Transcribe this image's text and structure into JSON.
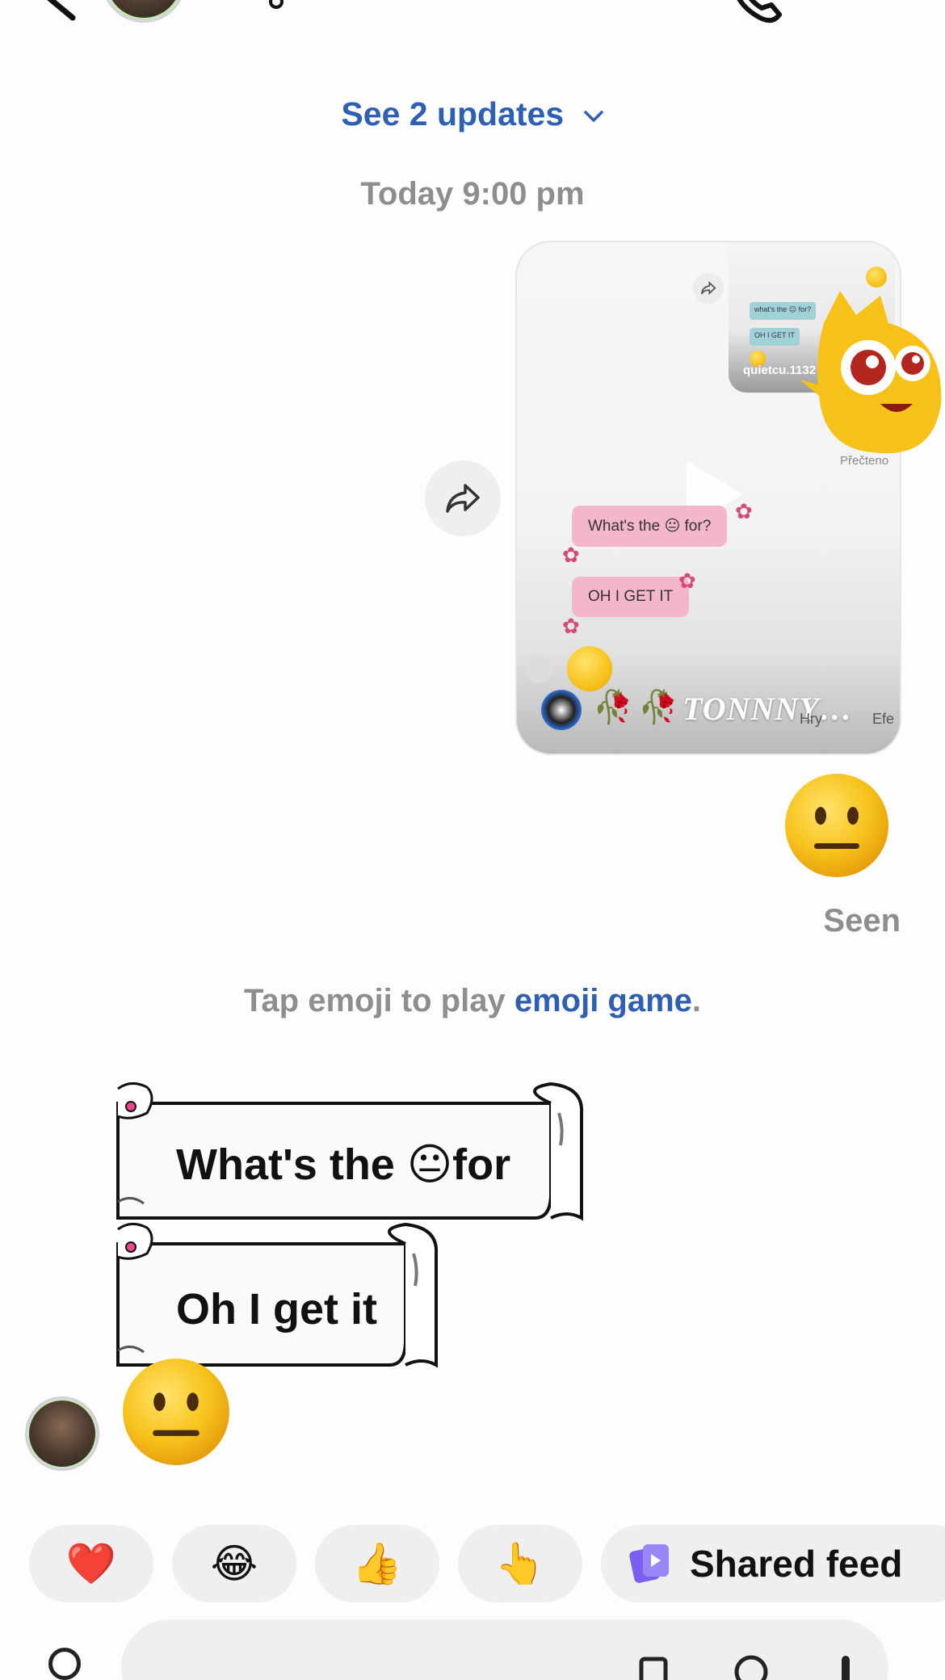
{
  "header": {
    "back_icon": "chevron-left-icon",
    "avatar": "profile-photo",
    "status_icon": "swirl-sparkle-icon",
    "call_icon": "phone-icon",
    "more_icon": "more-horizontal-icon"
  },
  "updates": {
    "label": "See 2 updates"
  },
  "timestamp": "Today 9:00 pm",
  "shared_video": {
    "caption": "TONNNY…",
    "inner_bubble_1": "What's the 😐 for?",
    "inner_bubble_2": "OH I GET IT",
    "mini_bubble_1": "what's the 😐 for?",
    "mini_bubble_2": "OH I GET IT",
    "mini_username": "quietcu.1132",
    "seen_label": "Přečteno",
    "bottom_label_1": "Hry",
    "bottom_label_2": "Efe"
  },
  "sent_emoji": "😐",
  "seen_label": "Seen",
  "emoji_hint": {
    "prefix": "Tap emoji to play ",
    "link": "emoji game",
    "suffix": "."
  },
  "received": {
    "bubble_1": "What's the 😐for",
    "bubble_2": "Oh I get it",
    "emoji": "😐"
  },
  "reactions": [
    "❤️",
    "😂",
    "👍",
    "👆"
  ],
  "shared_feed": {
    "label": "Shared feed",
    "icon": "shared-feed-icon"
  },
  "colors": {
    "link": "#2f5fb3",
    "muted": "#8e8e8e",
    "chip": "#efefef",
    "feed_icon": "#7a5ff0"
  }
}
